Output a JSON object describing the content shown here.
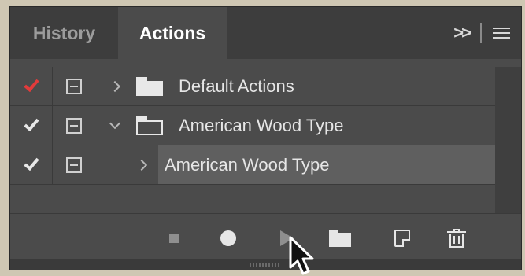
{
  "tabs": {
    "history_label": "History",
    "actions_label": "Actions"
  },
  "tabbar_controls": {
    "expand_icon": "double-chevron-right-icon",
    "menu_icon": "hamburger-menu-icon"
  },
  "actions": [
    {
      "label": "Default Actions",
      "checked": true,
      "check_color": "#e23b3b",
      "expanded": false,
      "type": "set",
      "selected": false
    },
    {
      "label": "American Wood Type",
      "checked": true,
      "check_color": "#e8e8e8",
      "expanded": true,
      "type": "set",
      "selected": false
    },
    {
      "label": "American Wood Type",
      "checked": true,
      "check_color": "#e8e8e8",
      "expanded": false,
      "type": "action",
      "selected": true
    }
  ],
  "toolbar": {
    "buttons": [
      "stop-icon",
      "record-icon",
      "play-icon",
      "new-set-folder-icon",
      "new-action-icon",
      "trash-icon"
    ]
  },
  "colors": {
    "panel_bg": "#4b4b4b",
    "tab_inactive": "#3d3d3d",
    "selected_row": "#5f5f5f",
    "accent_red": "#e23b3b",
    "page_bg": "#cfc7b3"
  }
}
